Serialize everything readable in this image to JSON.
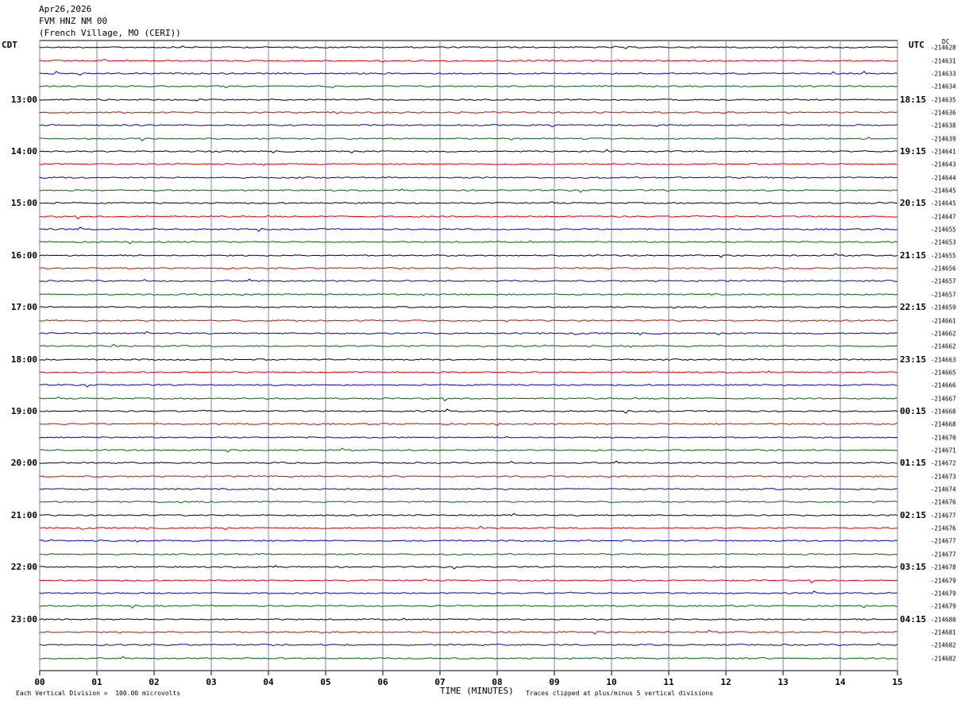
{
  "header": {
    "date": "Apr26,2026",
    "station": "FVM HNZ NM 00",
    "location": "(French Village, MO (CERI))"
  },
  "labels": {
    "left_tz": "CDT",
    "right_tz": "UTC",
    "dc": "DC",
    "xlabel": "TIME (MINUTES)",
    "scale_note": "Each Vertical Division =  100.00 microvolts",
    "clip_note": "Traces clipped at plus/minus 5 vertical divisions"
  },
  "chart_data": {
    "type": "line",
    "title": "FVM HNZ NM 00",
    "xlabel": "TIME (MINUTES)",
    "xlim": [
      0,
      15
    ],
    "x_ticks": [
      "00",
      "01",
      "02",
      "03",
      "04",
      "05",
      "06",
      "07",
      "08",
      "09",
      "10",
      "11",
      "12",
      "13",
      "14",
      "15"
    ],
    "trace_count": 48,
    "trace_colors": [
      "#000000",
      "#e00000",
      "#0000c0",
      "#006400"
    ],
    "grid_color": "#8080c0",
    "left_hour_labels": [
      "13:00",
      "14:00",
      "15:00",
      "16:00",
      "17:00",
      "18:00",
      "19:00",
      "20:00",
      "21:00",
      "22:00",
      "23:00"
    ],
    "right_hour_labels": [
      "18:15",
      "19:15",
      "20:15",
      "21:15",
      "22:15",
      "23:15",
      "00:15",
      "01:15",
      "02:15",
      "03:15",
      "04:15"
    ],
    "dc_offsets": [
      "-214628",
      "-214631",
      "-214633",
      "-214634",
      "-214635",
      "-214636",
      "-214638",
      "-214639",
      "-214641",
      "-214643",
      "-214644",
      "-214645",
      "-214645",
      "-214647",
      "-214655",
      "-214653",
      "-214655",
      "-214656",
      "-214657",
      "-214657",
      "-214659",
      "-214661",
      "-214662",
      "-214662",
      "-214663",
      "-214665",
      "-214666",
      "-214667",
      "-214668",
      "-214668",
      "-214670",
      "-214671",
      "-214672",
      "-214673",
      "-214674",
      "-214676",
      "-214677",
      "-214676",
      "-214677",
      "-214677",
      "-214678",
      "-214679",
      "-214679",
      "-214679",
      "-214680",
      "-214681",
      "-214682",
      "-214682"
    ]
  }
}
